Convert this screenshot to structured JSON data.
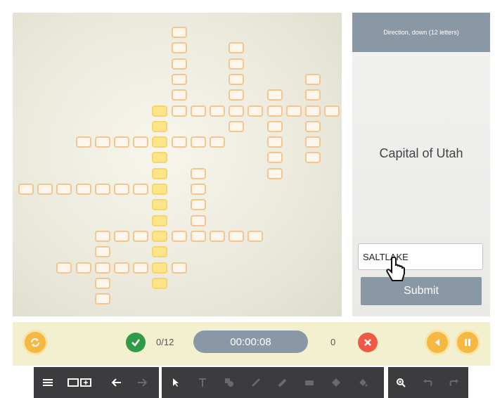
{
  "clue_panel": {
    "direction_label": "Direction, down (12 letters)",
    "clue_text": "Capital of Utah",
    "answer_value": "SALTLAKE",
    "submit_label": "Submit"
  },
  "status": {
    "progress": "0/12",
    "timer": "00:00:08",
    "wrong_count": "0"
  },
  "colors": {
    "cell_border": "#f4c58c",
    "highlight": "#fde58a",
    "accent_button": "#f5b843",
    "panel_header": "#8a97a5"
  },
  "icons": {
    "restart": "refresh-icon",
    "correct": "check-circle-icon",
    "wrong": "x-circle-icon",
    "prev": "volume-icon",
    "pause": "pause-icon",
    "menu": "hamburger-icon",
    "pages": "add-page-icon",
    "undo": "undo-icon",
    "redo": "redo-icon",
    "zoom": "zoom-icon"
  }
}
